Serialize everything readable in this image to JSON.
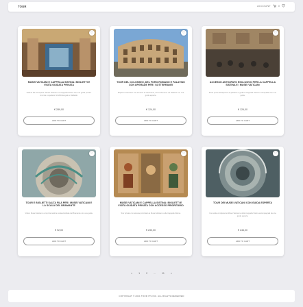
{
  "header": {
    "logo": "TOUR",
    "account": "ACCOUNT",
    "cart_count": "0"
  },
  "products": [
    {
      "title": "MUSEI VATICANI E CAPPELLA SISTINA: BIGLIETTI E VISITA GUIDATA PRIVATA",
      "desc": "Salta la fila ed esplora i Musei Vaticani e la Cappella Sistina con una guida privata. Ammira i capolavori di Michelangelo e Raffaello.",
      "price": "€ 289,00",
      "button": "ADD TO CART",
      "image": "vatican-hall"
    },
    {
      "title": "TOUR DEL COLOSSEO, DEL FORO ROMANO E PALATINO CON UPGRADE PER I SOTTERRANEI",
      "desc": "Esplora il Colosseo con accesso ai sotterranei, il Foro Romano e il Palatino con una guida esperta.",
      "price": "€ 124,00",
      "button": "ADD TO CART",
      "image": "colosseum"
    },
    {
      "title": "ACCESSO ANTICIPATO ESCLUSIVO PER LA CAPPELLA SISTINA E I MUSEI VATICANI",
      "desc": "Entra prima dell'apertura al pubblico e goditi la Cappella Sistina in tranquillità con una guida.",
      "price": "€ 126,00",
      "button": "ADD TO CART",
      "image": "sistine"
    },
    {
      "title": "TOUR E BIGLIETTI SALTA FILA PER I MUSEI VATICANI E LA SCALA DEL BRAMANTE",
      "desc": "Visita i Musei Vaticani e scopri la celebre scala elicoidale del Bramante con una guida.",
      "price": "€ 92,00",
      "button": "ADD TO CART",
      "image": "bramante"
    },
    {
      "title": "MUSEI VATICANI E CAPPELLA SISTINA: BIGLIETTI E VISITA GUIDATA PRIVATA CON ACCESSO PRIORITARIO",
      "desc": "Tour privato con accesso prioritario ai Musei Vaticani e alla Cappella Sistina.",
      "price": "€ 230,00",
      "button": "ADD TO CART",
      "image": "raphael"
    },
    {
      "title": "TOUR DEI MUSEI VATICANI CON GUIDA ESPERTA",
      "desc": "Una visita completa dei Musei Vaticani e della Cappella Sistina accompagnati da una guida esperta.",
      "price": "€ 246,00",
      "button": "ADD TO CART",
      "image": "spiral"
    }
  ],
  "pagination": [
    "«",
    "1",
    "2",
    "...",
    "11",
    "»"
  ],
  "footer": {
    "copyright": "COPYRIGHT © 2021 TOUR ITS INC. ALL RIGHTS RESERVED"
  }
}
